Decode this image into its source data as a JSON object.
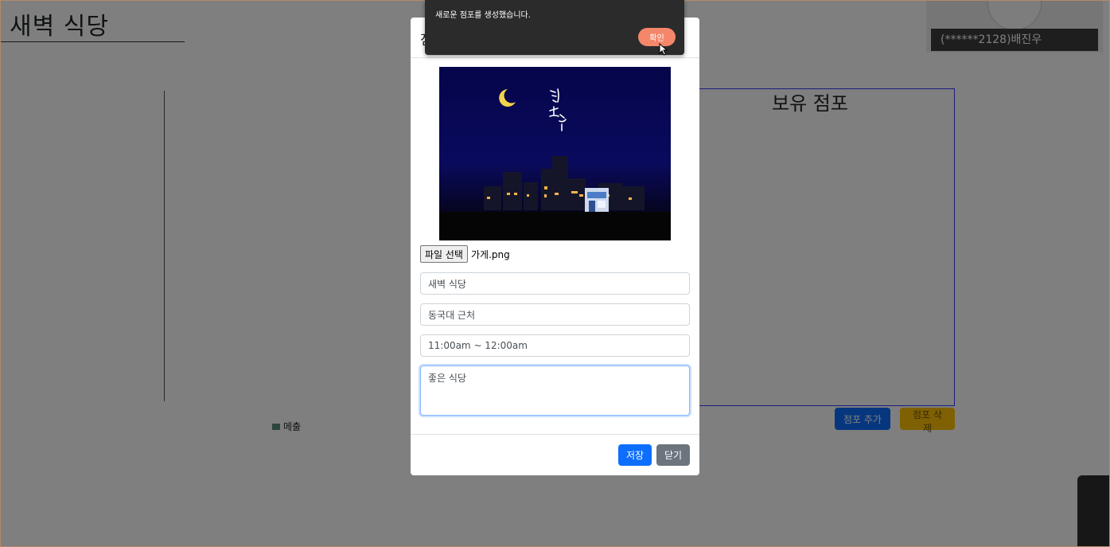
{
  "page": {
    "title": "새벽 식당",
    "legend_label": "메출",
    "legend_color": "#5b8c7a",
    "stores_title": "보유 점포",
    "add_store_label": "점포 추가",
    "delete_store_label": "점포 삭제"
  },
  "video": {
    "participant_name": "(******2128)배진우"
  },
  "alert": {
    "message": "새로운 점포를 생성했습니다.",
    "confirm_label": "확인"
  },
  "modal": {
    "title": "점",
    "file_button_label": "파일 선택",
    "file_name": "가게.png",
    "fields": {
      "name_value": "새벽 식당",
      "location_value": "동국대 근처",
      "hours_value": "11:00am ~ 12:00am",
      "description_value": "좋은 식당"
    },
    "save_label": "저장",
    "close_label": "닫기"
  },
  "colors": {
    "primary": "#0d6efd",
    "warning": "#ffc107",
    "secondary": "#6c757d",
    "alert_confirm": "#f4876a",
    "overlay": "rgba(0,0,0,0.5)"
  }
}
